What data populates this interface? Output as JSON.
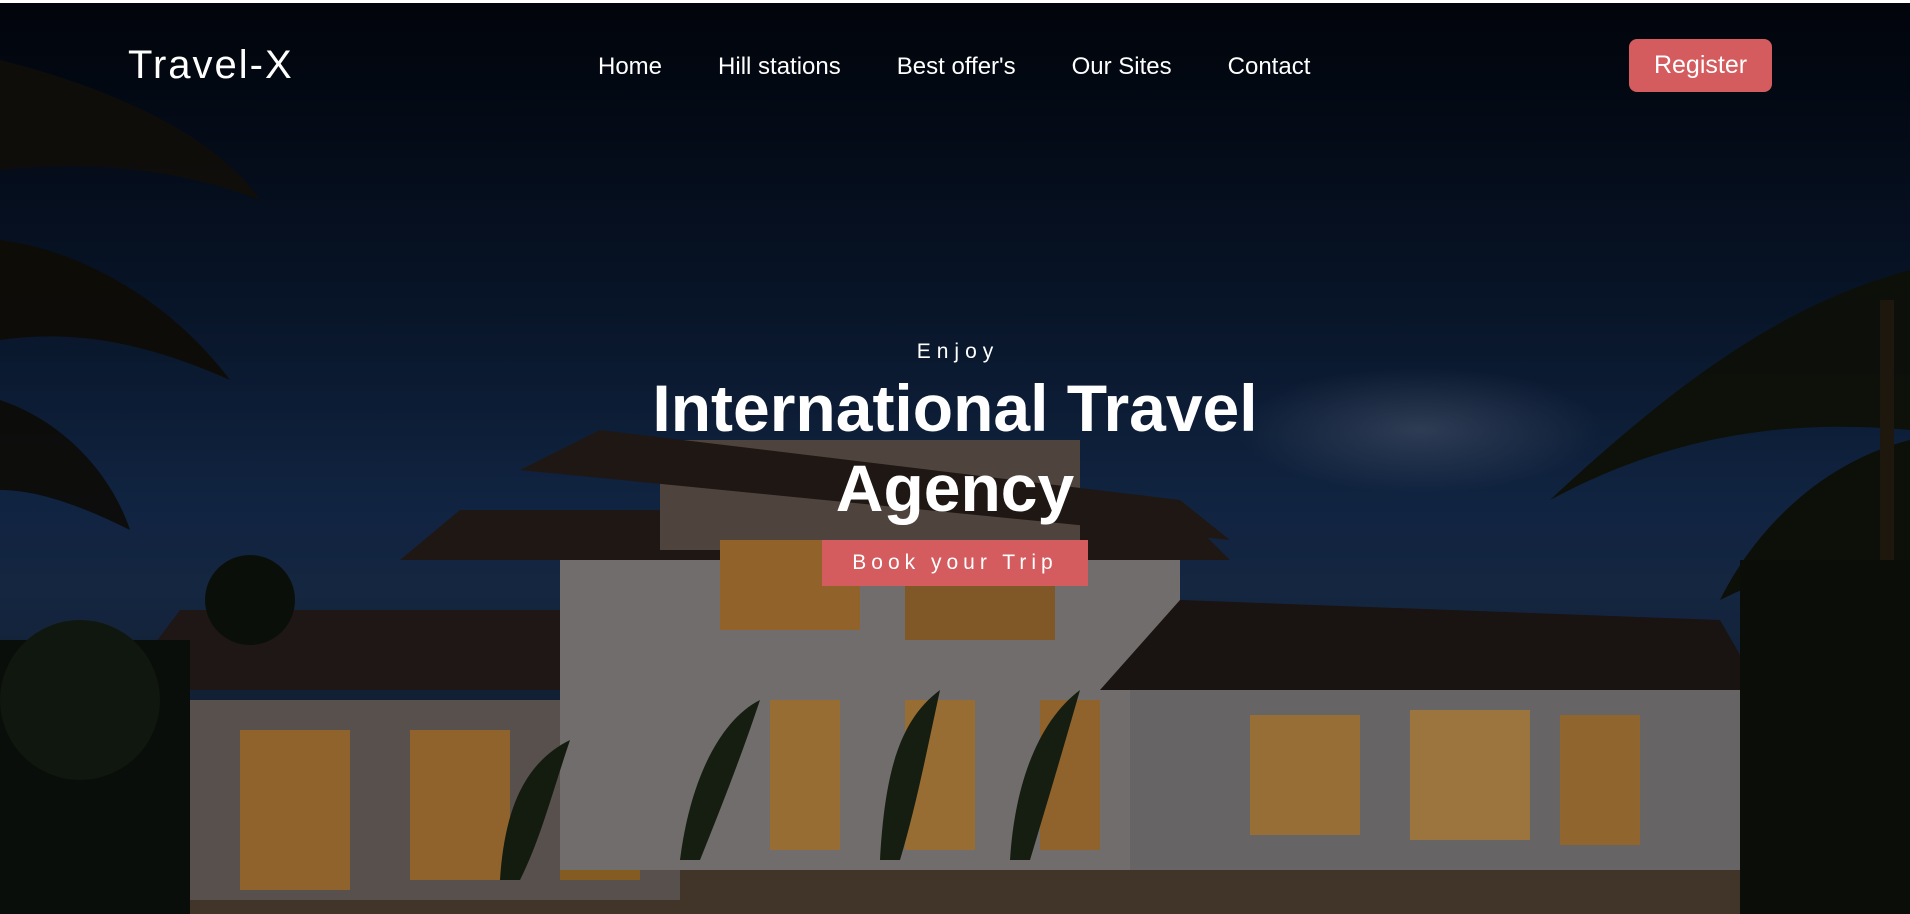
{
  "header": {
    "logo": "Travel-X",
    "nav": [
      "Home",
      "Hill stations",
      "Best offer's",
      "Our Sites",
      "Contact"
    ],
    "register_label": "Register"
  },
  "hero": {
    "eyebrow": "Enjoy",
    "headline": "International Travel Agency",
    "cta_label": "Book your Trip",
    "background_image": "night-villa-with-pool-and-palm-trees"
  },
  "colors": {
    "accent": "#d45b5e",
    "text": "#ffffff",
    "sky": "#0a1a33"
  }
}
